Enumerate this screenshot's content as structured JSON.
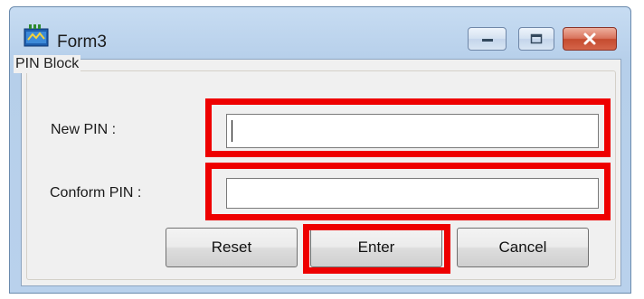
{
  "window": {
    "title": "Form3",
    "controls": [
      "minimize-icon",
      "maximize-icon",
      "close-icon"
    ]
  },
  "group": {
    "label": "PIN Block"
  },
  "fields": {
    "new_pin_label": "New PIN :",
    "new_pin_value": "",
    "confirm_pin_label": "Conform PIN :",
    "confirm_pin_value": ""
  },
  "buttons": {
    "reset": "Reset",
    "enter": "Enter",
    "cancel": "Cancel"
  },
  "colors": {
    "highlight": "#ee0000",
    "close_button": "#c54b2f"
  }
}
